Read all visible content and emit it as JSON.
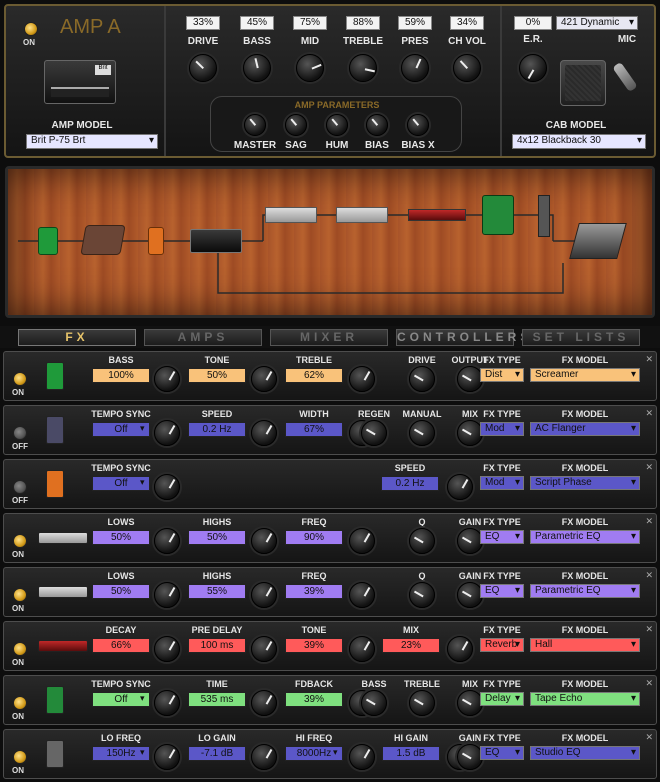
{
  "amp": {
    "title": "AMP A",
    "power": "ON",
    "model_label": "AMP MODEL",
    "model": "Brit P-75 Brt",
    "knobs": [
      {
        "label": "DRIVE",
        "value": "33%"
      },
      {
        "label": "BASS",
        "value": "45%"
      },
      {
        "label": "MID",
        "value": "75%"
      },
      {
        "label": "TREBLE",
        "value": "88%"
      },
      {
        "label": "PRES",
        "value": "59%"
      },
      {
        "label": "CH VOL",
        "value": "34%"
      }
    ],
    "params_label": "AMP PARAMETERS",
    "params": [
      "MASTER",
      "SAG",
      "HUM",
      "BIAS",
      "BIAS X"
    ],
    "er_label": "E.R.",
    "er_value": "0%",
    "mic_label": "MIC",
    "mic_model": "421 Dynamic",
    "cab_label": "CAB MODEL",
    "cab_model": "4x12 Blackback 30"
  },
  "tabs": [
    "FX",
    "AMPS",
    "MIXER",
    "CONTROLLERS",
    "SET LISTS"
  ],
  "colors": {
    "accent": "#e6c36a",
    "orange": "#f9c27a",
    "blue": "#5b57c8",
    "purple": "#a07cf2",
    "red": "#ff5a5a",
    "green": "#7fe07f"
  },
  "fx": [
    {
      "power": "ON",
      "on": true,
      "icon": "green-overdrive-pedal-icon",
      "color": "orange",
      "params": [
        {
          "label": "BASS",
          "value": "100%"
        },
        {
          "label": "TONE",
          "value": "50%"
        },
        {
          "label": "TREBLE",
          "value": "62%"
        },
        {
          "label": "DRIVE"
        },
        {
          "label": "OUTPUT"
        }
      ],
      "type": "Dist",
      "model": "Screamer"
    },
    {
      "power": "OFF",
      "on": false,
      "icon": "flanger-pedal-icon",
      "color": "blue",
      "params": [
        {
          "label": "TEMPO SYNC",
          "value": "Off",
          "dropdown": true
        },
        {
          "label": "SPEED",
          "value": "0.2 Hz"
        },
        {
          "label": "WIDTH",
          "value": "67%"
        },
        {
          "label": "REGEN"
        },
        {
          "label": "MANUAL"
        },
        {
          "label": "MIX"
        }
      ],
      "type": "Mod",
      "model": "AC Flanger"
    },
    {
      "power": "OFF",
      "on": false,
      "icon": "phaser-pedal-icon",
      "color": "blue",
      "params": [
        {
          "label": "TEMPO SYNC",
          "value": "Off",
          "dropdown": true
        },
        {
          "label": "SPEED",
          "value": "0.2 Hz"
        }
      ],
      "type": "Mod",
      "model": "Script Phase"
    },
    {
      "power": "ON",
      "on": true,
      "icon": "rack-eq-icon",
      "color": "purple",
      "params": [
        {
          "label": "LOWS",
          "value": "50%"
        },
        {
          "label": "HIGHS",
          "value": "50%"
        },
        {
          "label": "FREQ",
          "value": "90%"
        },
        {
          "label": "Q"
        },
        {
          "label": "GAIN"
        }
      ],
      "type": "EQ",
      "model": "Parametric EQ"
    },
    {
      "power": "ON",
      "on": true,
      "icon": "rack-eq-icon",
      "color": "purple",
      "params": [
        {
          "label": "LOWS",
          "value": "50%"
        },
        {
          "label": "HIGHS",
          "value": "55%"
        },
        {
          "label": "FREQ",
          "value": "39%"
        },
        {
          "label": "Q"
        },
        {
          "label": "GAIN"
        }
      ],
      "type": "EQ",
      "model": "Parametric EQ"
    },
    {
      "power": "ON",
      "on": true,
      "icon": "rack-reverb-icon",
      "color": "red",
      "params": [
        {
          "label": "DECAY",
          "value": "66%"
        },
        {
          "label": "PRE DELAY",
          "value": "100 ms"
        },
        {
          "label": "TONE",
          "value": "39%"
        },
        {
          "label": "MIX",
          "value": "23%"
        }
      ],
      "type": "Reverb",
      "model": "Hall"
    },
    {
      "power": "ON",
      "on": true,
      "icon": "tape-echo-icon",
      "color": "green",
      "params": [
        {
          "label": "TEMPO SYNC",
          "value": "Off",
          "dropdown": true
        },
        {
          "label": "TIME",
          "value": "535 ms"
        },
        {
          "label": "FDBACK",
          "value": "39%"
        },
        {
          "label": "BASS"
        },
        {
          "label": "TREBLE"
        },
        {
          "label": "MIX"
        }
      ],
      "type": "Delay",
      "model": "Tape Echo"
    },
    {
      "power": "ON",
      "on": true,
      "icon": "studio-eq-icon",
      "color": "blue",
      "params": [
        {
          "label": "LO FREQ",
          "value": "150Hz",
          "dropdown": true
        },
        {
          "label": "LO GAIN",
          "value": "-7.1 dB"
        },
        {
          "label": "HI FREQ",
          "value": "8000Hz",
          "dropdown": true
        },
        {
          "label": "HI GAIN",
          "value": "1.5 dB"
        },
        {
          "label": "GAIN"
        }
      ],
      "type": "EQ",
      "model": "Studio EQ"
    }
  ]
}
